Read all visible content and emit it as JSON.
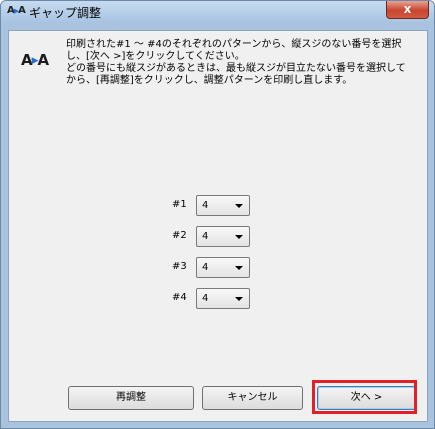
{
  "window": {
    "title": "ギャップ調整",
    "close_label": "x",
    "icon_name": "gap-adjust-icon"
  },
  "message": {
    "line1": "印刷された#1 ～ #4のそれぞれのパターンから、縦スジのない番号を選択",
    "line2": "し、[次へ >]をクリックしてください。",
    "line3": "どの番号にも縦スジがあるときは、最も縦スジが目立たない番号を選択して",
    "line4": "から、[再調整]をクリックし、調整パターンを印刷し直します。"
  },
  "selections": [
    {
      "label": "#1",
      "value": "4"
    },
    {
      "label": "#2",
      "value": "4"
    },
    {
      "label": "#3",
      "value": "4"
    },
    {
      "label": "#4",
      "value": "4"
    }
  ],
  "buttons": {
    "readjust": "再調整",
    "cancel": "キャンセル",
    "next": "次へ >"
  },
  "colors": {
    "highlight": "#e3202a",
    "frame": "#a9c3de",
    "close_button": "#c7452f"
  }
}
